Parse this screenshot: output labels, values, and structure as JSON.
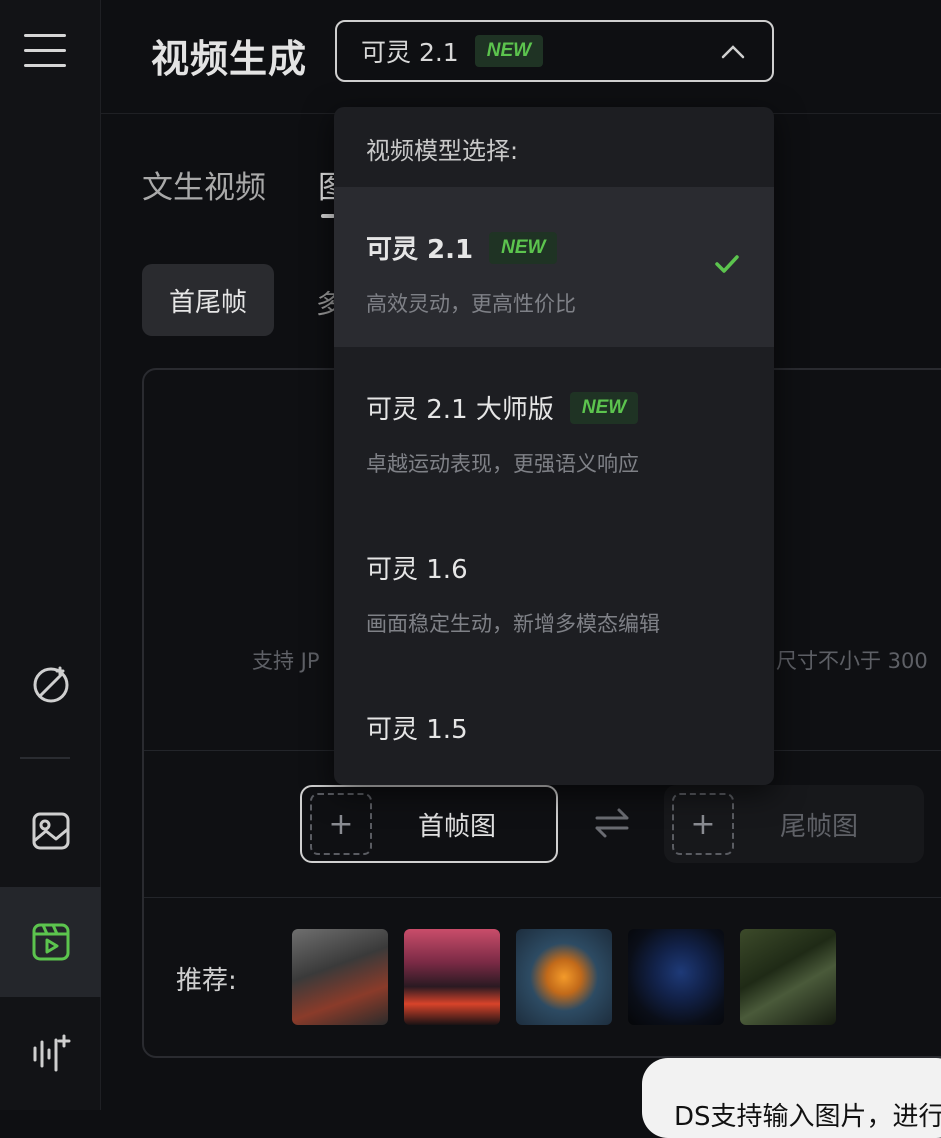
{
  "header": {
    "title": "视频生成",
    "selected_model": "可灵 2.1",
    "selected_badge": "NEW"
  },
  "tabs": [
    "文生视频",
    "图"
  ],
  "modes": [
    "首尾帧",
    "多"
  ],
  "upload": {
    "hint_left": "支持 JP",
    "hint_right": "尺寸不小于 300"
  },
  "frames": {
    "first_label": "首帧图",
    "last_label": "尾帧图",
    "plus": "+"
  },
  "recommend": {
    "label": "推荐:",
    "thumbnails": [
      "cat-in-red-armor",
      "lava-sunset",
      "pumpkin-house",
      "dark-bird",
      "bamboo-forest-girl"
    ]
  },
  "toast": {
    "text": "DS支持输入图片，进行"
  },
  "dropdown": {
    "header": "视频模型选择:",
    "items": [
      {
        "name": "可灵 2.1",
        "badge": "NEW",
        "desc": "高效灵动，更高性价比",
        "selected": true
      },
      {
        "name": "可灵 2.1 大师版",
        "badge": "NEW",
        "desc": "卓越运动表现，更强语义响应",
        "selected": false
      },
      {
        "name": "可灵 1.6",
        "badge": "",
        "desc": "画面稳定生动，新增多模态编辑",
        "selected": false
      },
      {
        "name": "可灵 1.5",
        "badge": "",
        "desc": "",
        "selected": false
      }
    ]
  },
  "colors": {
    "accent_green": "#5cc44e",
    "background": "#0e0f12",
    "dropdown_bg": "#1d1e22"
  },
  "icons": [
    "menu-icon",
    "magic-wand-icon",
    "image-icon",
    "video-icon",
    "audio-icon",
    "chevron-up-icon",
    "check-icon",
    "swap-icon"
  ]
}
